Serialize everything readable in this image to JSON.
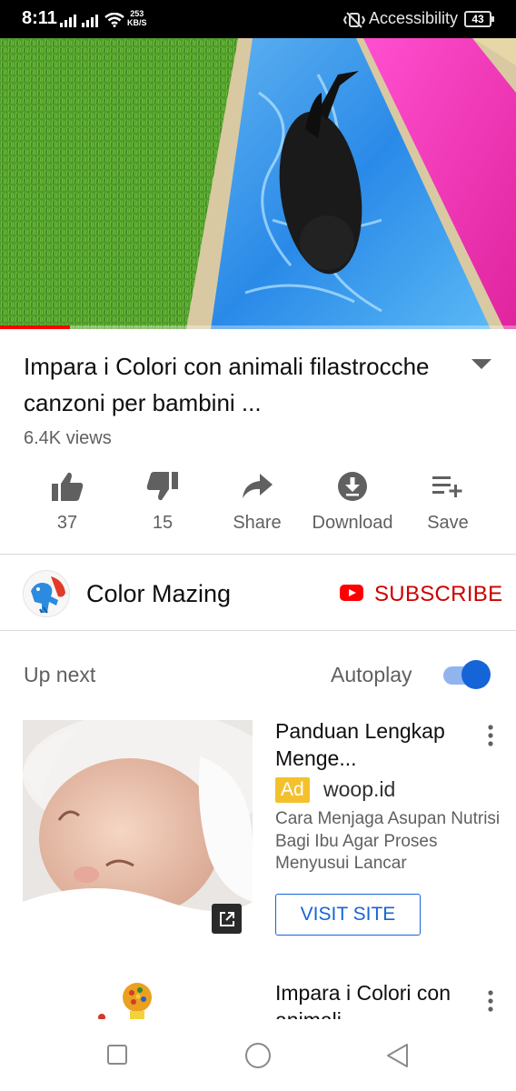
{
  "status_bar": {
    "time": "8:11",
    "net_speed_value": "253",
    "net_speed_unit": "KB/S",
    "accessibility_label": "Accessibility",
    "battery": "43"
  },
  "video": {
    "progress_fraction": 0.135
  },
  "title": "Impara i Colori con animali filastrocche canzoni per bambini ...",
  "views": "6.4K views",
  "actions": {
    "like_count": "37",
    "dislike_count": "15",
    "share_label": "Share",
    "download_label": "Download",
    "save_label": "Save"
  },
  "channel": {
    "name": "Color Mazing",
    "subscribe_label": "SUBSCRIBE"
  },
  "up_next": {
    "label": "Up next",
    "autoplay_label": "Autoplay",
    "autoplay_on": true
  },
  "ad": {
    "title": "Panduan Lengkap Menge...",
    "badge": "Ad",
    "domain": "woop.id",
    "description": "Cara Menjaga Asupan Nutrisi Bagi Ibu Agar Proses Menyusui Lancar",
    "cta": "VISIT SITE"
  },
  "next_video": {
    "title": "Impara i Colori con animali"
  },
  "colors": {
    "accent_red": "#ff0000",
    "subscribe_red": "#cc0000",
    "link_blue": "#1565d8",
    "ad_badge": "#f4c12e"
  }
}
